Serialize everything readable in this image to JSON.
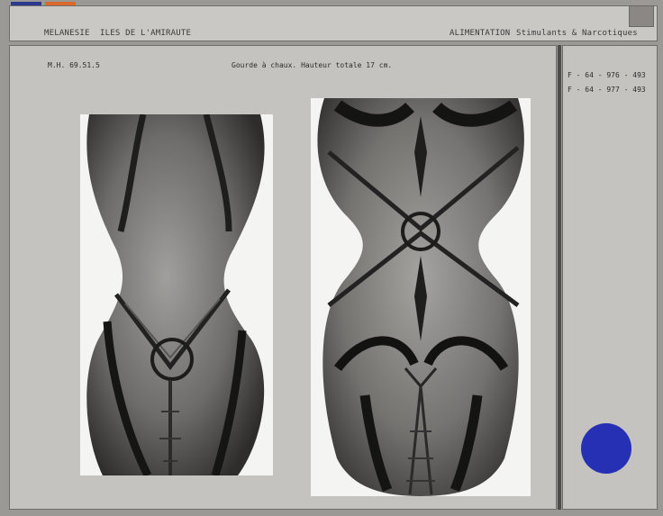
{
  "header": {
    "region": "MELANESIE",
    "location": "ILES DE L'AMIRAUTE",
    "category": "ALIMENTATION",
    "subcategory": "Stimulants & Narcotiques"
  },
  "record": {
    "inventory_number": "M.H. 69.51.5",
    "description": "Gourde à chaux. Hauteur totale 17 cm.",
    "photo_refs": [
      "F - 64 - 976 - 493",
      "F - 64 - 977 - 493"
    ]
  },
  "colors": {
    "dot_blue": "#2b3a8f",
    "dot_orange": "#d9692c",
    "side_dot": "#2630b4"
  }
}
